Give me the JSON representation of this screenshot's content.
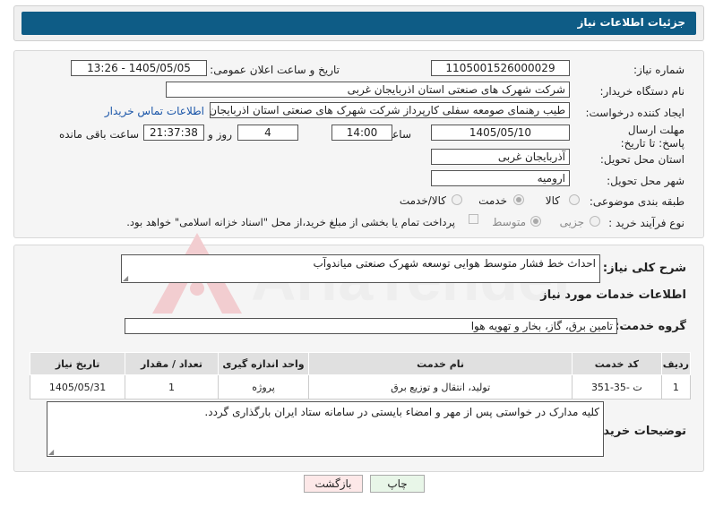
{
  "header": {
    "title": "جزئیات اطلاعات نیاز"
  },
  "form": {
    "need_number_label": "شماره نیاز:",
    "need_number": "1105001526000029",
    "announce_label": "تاریخ و ساعت اعلان عمومی:",
    "announce_value": "1405/05/05 - 13:26",
    "buyer_org_label": "نام دستگاه خریدار:",
    "buyer_org": "شرکت شهرک های صنعتی استان اذربایجان غربی",
    "creator_label": "ایجاد کننده درخواست:",
    "creator": "طیب رهنمای صومعه سفلی کارپرداز شرکت شهرک های صنعتی استان اذربایجان غربی",
    "buyer_contact_link": "اطلاعات تماس خریدار",
    "deadline_label": "مهلت ارسال پاسخ: تا تاریخ:",
    "deadline_date": "1405/05/10",
    "time_label": "ساعت",
    "deadline_time": "14:00",
    "days_value": "4",
    "days_label": "روز و",
    "remaining_time": "21:37:38",
    "remaining_label": "ساعت باقی مانده",
    "province_label": "استان محل تحویل:",
    "province": "آذربایجان غربی",
    "city_label": "شهر محل تحویل:",
    "city": "ارومیه",
    "category_label": "طبقه بندی موضوعی:",
    "category_options": [
      "کالا",
      "خدمت",
      "کالا/خدمت"
    ],
    "category_selected": "خدمت",
    "process_label": "نوع فرآیند خرید :",
    "process_options": [
      "جزیی",
      "متوسط"
    ],
    "process_selected": "متوسط",
    "payment_note": "پرداخت تمام یا بخشی از مبلغ خرید،از محل \"اسناد خزانه اسلامی\" خواهد بود."
  },
  "summary": {
    "label": "شرح کلی نیاز:",
    "text": "احداث خط فشار متوسط هوایی توسعه شهرک صنعتی میاندوآب"
  },
  "services": {
    "section_title": "اطلاعات خدمات مورد نیاز",
    "group_label": "گروه خدمت:",
    "group_value": "تامین برق، گاز، بخار و تهویه هوا",
    "columns": [
      "ردیف",
      "کد خدمت",
      "نام خدمت",
      "واحد اندازه گیری",
      "تعداد / مقدار",
      "تاریخ نیاز"
    ],
    "rows": [
      {
        "row": "1",
        "code": "ت -35-351",
        "name": "تولید، انتقال و توزیع برق",
        "unit": "پروژه",
        "qty": "1",
        "date": "1405/05/31"
      }
    ]
  },
  "buyer_notes": {
    "label": "توضیحات خریدار:",
    "text": "کلیه مدارک در خواستی پس از مهر و امضاء بایستی در سامانه ستاد ایران بارگذاری گردد."
  },
  "buttons": {
    "print": "چاپ",
    "back": "بازگشت"
  },
  "watermark": {
    "text": "AriaTender.net"
  },
  "colors": {
    "header": "#0e5c86",
    "link": "#1a55a8",
    "back_button": "#fde8e8",
    "print_button": "#e8f6e8"
  }
}
